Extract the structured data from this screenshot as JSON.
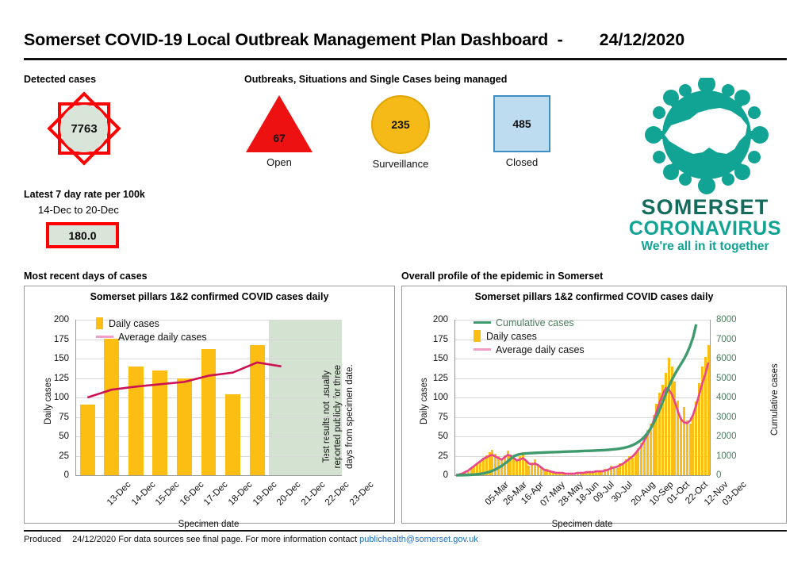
{
  "header": {
    "title": "Somerset COVID-19 Local Outbreak Management Plan Dashboard  -",
    "date": "24/12/2020"
  },
  "detected": {
    "label": "Detected cases",
    "value": "7763",
    "icon": "star-burst-icon",
    "border_color": "#ff0000",
    "fill_color": "#d9e5d8"
  },
  "outbreaks": {
    "label": "Outbreaks, Situations and Single Cases being managed",
    "items": [
      {
        "value": "67",
        "caption": "Open",
        "shape": "triangle-icon",
        "color": "#ee1111"
      },
      {
        "value": "235",
        "caption": "Surveillance",
        "shape": "circle-icon",
        "color": "#f5ba18"
      },
      {
        "value": "485",
        "caption": "Closed",
        "shape": "square-icon",
        "color": "#bedcef"
      }
    ]
  },
  "rate": {
    "label": "Latest 7 day rate per 100k",
    "range": "14-Dec to 20-Dec",
    "value": "180.0"
  },
  "logo": {
    "icon": "coronavirus-somerset-logo",
    "line1": "SOMERSET",
    "line2": "CORONAVIRUS",
    "tagline": "We're all in it together",
    "color_dark": "#136b5e",
    "color_main": "#11a394"
  },
  "sections": {
    "recent": "Most recent days of cases",
    "overall": "Overall profile of the epidemic in Somerset"
  },
  "footer": {
    "produced_label": "Produced",
    "produced_date": "24/12/2020",
    "text": "For data sources see final page. For more information contact ",
    "email": "publichealth@somerset.gov.uk"
  },
  "chart_data": [
    {
      "id": "recent-days-chart",
      "type": "bar",
      "title": "Somerset pillars 1&2 confirmed COVID cases daily",
      "xlabel": "Specimen date",
      "ylabel": "Daily cases",
      "ylim": [
        0,
        200
      ],
      "yticks": [
        0,
        25,
        50,
        75,
        100,
        125,
        150,
        175,
        200
      ],
      "grid": true,
      "legend_position": "top-left",
      "categories": [
        "13-Dec",
        "14-Dec",
        "15-Dec",
        "16-Dec",
        "17-Dec",
        "18-Dec",
        "19-Dec",
        "20-Dec",
        "21-Dec",
        "22-Dec",
        "23-Dec"
      ],
      "series": [
        {
          "name": "Daily cases",
          "type": "bar",
          "color": "#fdbe14",
          "values": [
            91,
            176,
            140,
            135,
            125,
            162,
            104,
            167,
            0,
            0,
            0
          ]
        },
        {
          "name": "Average daily cases",
          "type": "line",
          "color": "#cc1155",
          "legend_color": "#f0a0c8",
          "values": [
            100,
            110,
            114,
            117,
            120,
            128,
            132,
            145,
            140,
            null,
            null
          ]
        }
      ],
      "annotation": {
        "text": "Test results not usually reported publicly for three days from specimen date.",
        "lines": [
          "Test results not usually",
          "reported publicly for three",
          "days from specimen date."
        ],
        "region_start_category": "21-Dec",
        "region_end_category": "23-Dec",
        "region_color": "#d4e2d2",
        "rotation": -90
      }
    },
    {
      "id": "overall-epidemic-chart",
      "type": "bar",
      "title": "Somerset pillars 1&2 confirmed COVID cases daily",
      "xlabel": "Specimen date",
      "ylabel": "Daily cases",
      "ylabel_secondary": "Cumulative cases",
      "ylim": [
        0,
        200
      ],
      "yticks": [
        0,
        25,
        50,
        75,
        100,
        125,
        150,
        175,
        200
      ],
      "ylim_secondary": [
        0,
        8000
      ],
      "yticks_secondary": [
        0,
        1000,
        2000,
        3000,
        4000,
        5000,
        6000,
        7000,
        8000
      ],
      "grid": true,
      "legend_position": "top-left",
      "xticks": [
        "05-Mar",
        "26-Mar",
        "16-Apr",
        "07-May",
        "28-May",
        "18-Jun",
        "09-Jul",
        "30-Jul",
        "20-Aug",
        "10-Sep",
        "01-Oct",
        "22-Oct",
        "12-Nov",
        "03-Dec"
      ],
      "xtick_interval_days": 21,
      "series": [
        {
          "name": "Cumulative cases",
          "type": "line",
          "axis": "secondary",
          "color": "#3f9b6d",
          "values": [
            0,
            2,
            5,
            9,
            14,
            22,
            33,
            48,
            68,
            95,
            130,
            175,
            230,
            300,
            385,
            480,
            590,
            710,
            840,
            975,
            1040,
            1080,
            1105,
            1120,
            1130,
            1140,
            1148,
            1155,
            1162,
            1168,
            1174,
            1180,
            1186,
            1192,
            1198,
            1204,
            1210,
            1216,
            1222,
            1228,
            1234,
            1240,
            1246,
            1252,
            1258,
            1264,
            1270,
            1278,
            1286,
            1295,
            1305,
            1318,
            1332,
            1350,
            1372,
            1400,
            1435,
            1480,
            1540,
            1615,
            1710,
            1830,
            1980,
            2170,
            2400,
            2680,
            3010,
            3380,
            3780,
            4180,
            4560,
            4900,
            5200,
            5470,
            5720,
            5980,
            6280,
            6650,
            7100,
            7763
          ]
        },
        {
          "name": "Daily cases",
          "type": "bar",
          "axis": "primary",
          "color": "#fdbe14",
          "peak_value": 167,
          "peak_date": "20-Dec",
          "values": [
            0,
            1,
            2,
            3,
            5,
            8,
            11,
            14,
            18,
            22,
            26,
            30,
            33,
            28,
            24,
            20,
            26,
            32,
            27,
            22,
            18,
            25,
            30,
            18,
            12,
            16,
            20,
            14,
            9,
            6,
            8,
            5,
            3,
            2,
            4,
            3,
            2,
            1,
            3,
            2,
            4,
            3,
            2,
            5,
            4,
            3,
            6,
            5,
            4,
            8,
            7,
            12,
            10,
            9,
            15,
            14,
            20,
            25,
            22,
            30,
            35,
            42,
            50,
            58,
            66,
            78,
            92,
            106,
            116,
            132,
            151,
            140,
            120,
            96,
            74,
            88,
            70,
            66,
            78,
            95,
            118,
            140,
            152,
            167
          ]
        },
        {
          "name": "Average daily cases",
          "type": "line",
          "axis": "primary",
          "color": "#e8468a",
          "legend_color": "#f0a0c8",
          "values": [
            0,
            1,
            2,
            4,
            6,
            9,
            12,
            15,
            18,
            21,
            23,
            25,
            26,
            24,
            22,
            20,
            23,
            26,
            25,
            22,
            19,
            20,
            22,
            19,
            15,
            14,
            15,
            13,
            10,
            7,
            6,
            5,
            4,
            3,
            3,
            3,
            2,
            2,
            2,
            2,
            3,
            3,
            3,
            4,
            4,
            4,
            5,
            5,
            5,
            6,
            7,
            9,
            10,
            11,
            13,
            15,
            18,
            21,
            24,
            28,
            33,
            38,
            45,
            52,
            60,
            70,
            82,
            94,
            104,
            112,
            110,
            104,
            94,
            82,
            72,
            68,
            67,
            70,
            78,
            90,
            104,
            118,
            130,
            145
          ]
        }
      ]
    }
  ]
}
